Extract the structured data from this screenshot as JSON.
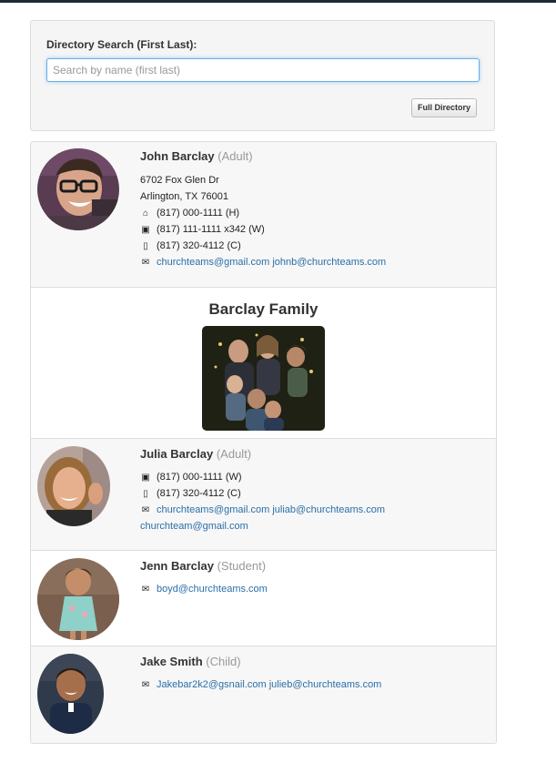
{
  "search": {
    "label": "Directory Search (First Last):",
    "placeholder": "Search by name (first last)",
    "value": "",
    "full_directory_label": "Full Directory"
  },
  "members": [
    {
      "name": "John Barclay",
      "role": "(Adult)",
      "address_line1": "6702 Fox Glen Dr",
      "address_line2": "Arlington, TX 76001",
      "phone_home": "(817) 000-1111 (H)",
      "phone_work": "(817) 111-1111 x342 (W)",
      "phone_cell": "(817) 320-4112 (C)",
      "emails": [
        "churchteams@gmail.com",
        "johnb@churchteams.com"
      ]
    },
    {
      "name": "Julia Barclay",
      "role": "(Adult)",
      "phone_work": "(817) 000-1111 (W)",
      "phone_cell": "(817) 320-4112 (C)",
      "emails": [
        "churchteams@gmail.com",
        "juliab@churchteams.com",
        "churchteam@gmail.com"
      ]
    },
    {
      "name": "Jenn Barclay",
      "role": "(Student)",
      "emails": [
        "boyd@churchteams.com"
      ]
    },
    {
      "name": "Jake Smith",
      "role": "(Child)",
      "emails": [
        "Jakebar2k2@gsnail.com",
        "julieb@churchteams.com"
      ]
    }
  ],
  "family": {
    "title": "Barclay Family"
  },
  "icons": {
    "home": "home-icon",
    "work": "briefcase-icon",
    "cell": "mobile-phone-icon",
    "email": "envelope-icon"
  },
  "colors": {
    "link": "#2a6fa8",
    "role": "#999999",
    "focus": "#66afe9"
  }
}
